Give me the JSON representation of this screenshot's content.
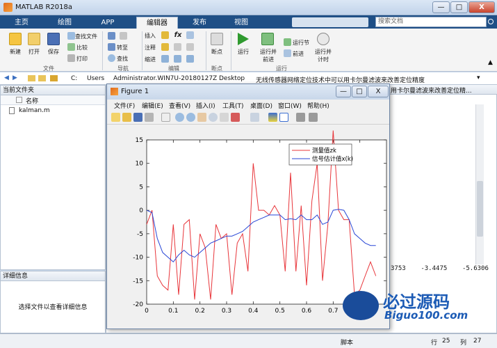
{
  "app": {
    "title": "MATLAB R2018a"
  },
  "window_controls": {
    "minimize": "—",
    "maximize": "□",
    "close": "X"
  },
  "tabs": [
    "主页",
    "绘图",
    "APP",
    "编辑器",
    "发布",
    "视图"
  ],
  "active_tab": "编辑器",
  "search": {
    "placeholder": "搜索文档"
  },
  "ribbon": {
    "file": {
      "new": "新建",
      "open": "打开",
      "save": "保存",
      "find_files": "查找文件",
      "compare": "比较",
      "print": "打印",
      "group": "文件"
    },
    "navigate": {
      "goto": "转至",
      "find": "查找",
      "group": "导航"
    },
    "edit": {
      "insert": "插入",
      "comment": "注释",
      "indent": "缩进",
      "fx": "fx",
      "group": "编辑"
    },
    "breakpoints": {
      "label": "断点",
      "group": "断点"
    },
    "run": {
      "run": "运行",
      "run_advance": "运行并\n前进",
      "run_section": "运行节",
      "advance": "前进",
      "run_time": "运行并\n计时",
      "group": "运行"
    }
  },
  "address": {
    "parts": [
      "C:",
      "Users",
      "Administrator.WIN7U-20180127Z",
      "Desktop",
      "无线传感器网络定位技术中可以用卡尔曼滤波来改善定位精度"
    ]
  },
  "current_folder": {
    "title": "当前文件夹",
    "col_name": "名称",
    "files": [
      "kalman.m"
    ]
  },
  "details": {
    "title": "详细信息",
    "empty_text": "选择文件以查看详细信息"
  },
  "bg_right": {
    "path_tail": "用卡尔曼滤波来改善定位精...",
    "values": "3753    -3.4475    -5.6306"
  },
  "status": {
    "script": "脚本",
    "row_label": "行",
    "row": "25",
    "col_label": "列",
    "col": "27"
  },
  "figure": {
    "title": "Figure 1",
    "menu": [
      "文件(F)",
      "编辑(E)",
      "查看(V)",
      "插入(I)",
      "工具(T)",
      "桌面(D)",
      "窗口(W)",
      "帮助(H)"
    ],
    "min": "—",
    "max": "□",
    "close": "X"
  },
  "chart_data": {
    "type": "line",
    "x": [
      0,
      0.02,
      0.04,
      0.06,
      0.08,
      0.1,
      0.12,
      0.14,
      0.16,
      0.18,
      0.2,
      0.22,
      0.24,
      0.26,
      0.28,
      0.3,
      0.32,
      0.34,
      0.36,
      0.38,
      0.4,
      0.42,
      0.44,
      0.46,
      0.48,
      0.5,
      0.52,
      0.54,
      0.56,
      0.58,
      0.6,
      0.62,
      0.64,
      0.66,
      0.68,
      0.7,
      0.72,
      0.74,
      0.76,
      0.78,
      0.8,
      0.82,
      0.84,
      0.86
    ],
    "series": [
      {
        "name": "测量值zk",
        "color": "#e8353a",
        "values": [
          -3,
          0,
          -14,
          -16,
          -17,
          -3,
          -18,
          -3,
          -2,
          -19,
          -5,
          -8,
          -19,
          -3,
          -6,
          -5,
          -18,
          -7,
          -5,
          -13,
          10,
          0,
          0,
          -1,
          1,
          -1,
          -13,
          8,
          -13,
          1,
          -16,
          2,
          10,
          -15,
          -3,
          17,
          0,
          -2,
          -2,
          -18,
          -17,
          -14,
          -11,
          -14
        ]
      },
      {
        "name": "信号估计值x(k)",
        "color": "#2846d6",
        "values": [
          0,
          -0.5,
          -6,
          -9,
          -10,
          -11,
          -9.5,
          -8.5,
          -9.5,
          -10,
          -9,
          -8,
          -7,
          -6.5,
          -6,
          -5.5,
          -5.5,
          -5,
          -4.5,
          -3.5,
          -2.5,
          -2,
          -1.5,
          -1,
          -1,
          -1,
          -2,
          -1.8,
          -2,
          -1,
          -2,
          -2,
          -1,
          -3,
          -2.5,
          0,
          0.2,
          0,
          -2,
          -5,
          -6,
          -7,
          -7.5,
          -7.5
        ]
      }
    ],
    "xlim": [
      0,
      0.9
    ],
    "ylim": [
      -20,
      15
    ],
    "xticks": [
      "0",
      "0.1",
      "0.2",
      "0.3",
      "0.4",
      "0.5",
      "0.6",
      "0.7",
      "0.8"
    ],
    "yticks": [
      "15",
      "10",
      "5",
      "0",
      "-5",
      "-10",
      "-15",
      "-20"
    ],
    "legend_position": "top-right",
    "grid": false
  },
  "watermark": {
    "cn": "必过源码",
    "url": "Biguo100.com"
  }
}
